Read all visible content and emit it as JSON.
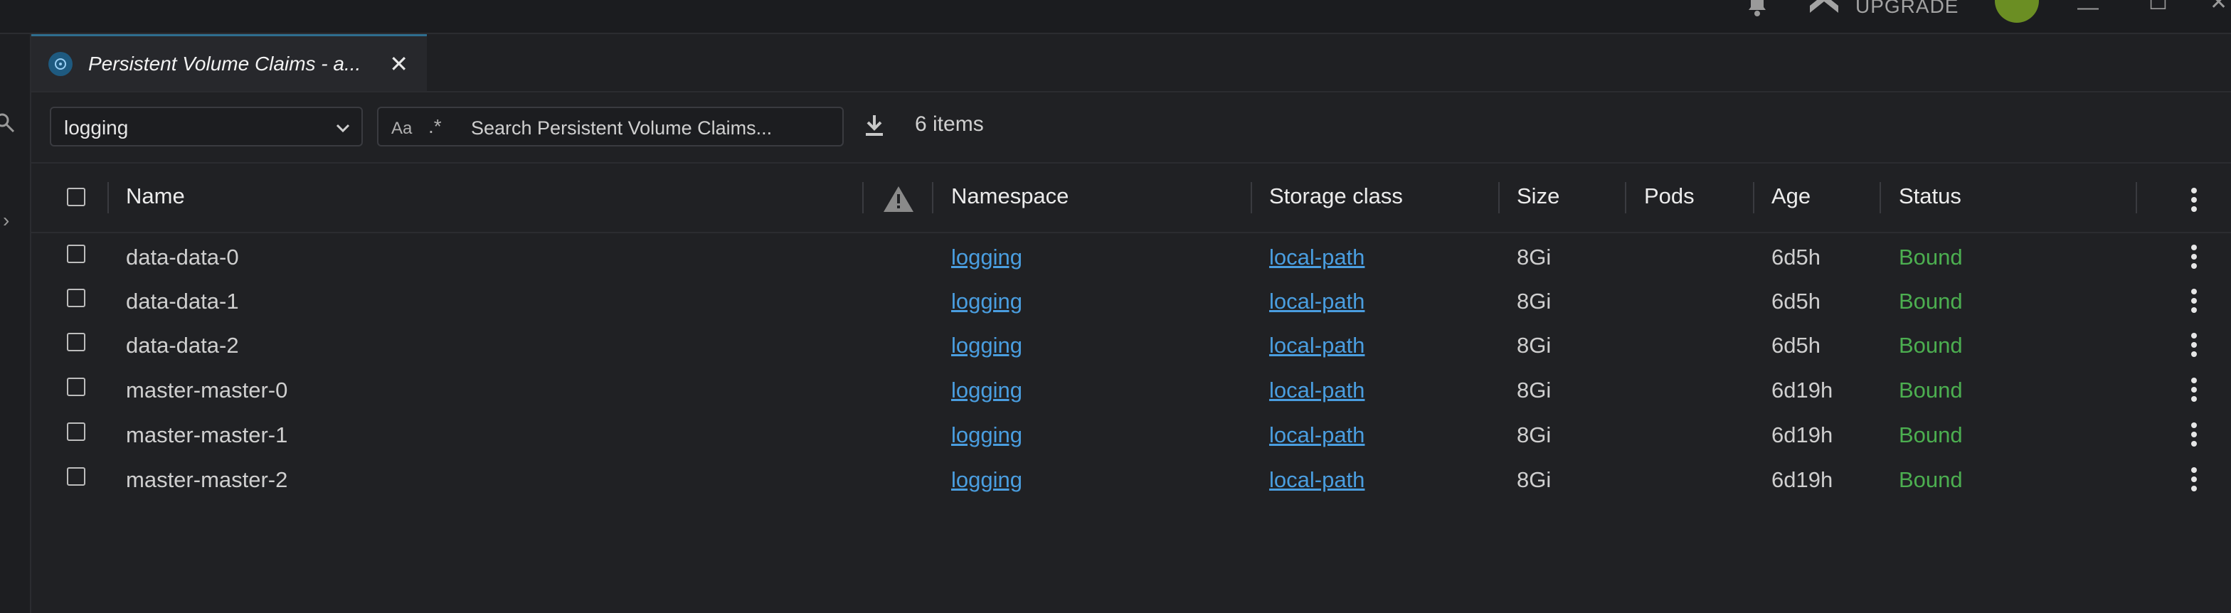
{
  "topbar": {
    "upgrade_label": "UPGRADE",
    "icons": [
      "bell-icon",
      "upgrade-icon",
      "avatar",
      "minimize-icon",
      "maximize-icon",
      "close-window-icon"
    ]
  },
  "tab": {
    "title": "Persistent Volume Claims - a...",
    "icon": "kubernetes-icon",
    "close_icon": "close-icon"
  },
  "toolbar": {
    "namespace_value": "logging",
    "search_case_label": "Aa",
    "search_regex_label": ".*",
    "search_placeholder": "Search Persistent Volume Claims...",
    "items_count": "6 items"
  },
  "table": {
    "columns": [
      "Name",
      "Namespace",
      "Storage class",
      "Size",
      "Pods",
      "Age",
      "Status"
    ],
    "rows": [
      {
        "name": "data-data-0",
        "namespace": "logging",
        "storage_class": "local-path",
        "size": "8Gi",
        "pods": "",
        "age": "6d5h",
        "status": "Bound"
      },
      {
        "name": "data-data-1",
        "namespace": "logging",
        "storage_class": "local-path",
        "size": "8Gi",
        "pods": "",
        "age": "6d5h",
        "status": "Bound"
      },
      {
        "name": "data-data-2",
        "namespace": "logging",
        "storage_class": "local-path",
        "size": "8Gi",
        "pods": "",
        "age": "6d5h",
        "status": "Bound"
      },
      {
        "name": "master-master-0",
        "namespace": "logging",
        "storage_class": "local-path",
        "size": "8Gi",
        "pods": "",
        "age": "6d19h",
        "status": "Bound"
      },
      {
        "name": "master-master-1",
        "namespace": "logging",
        "storage_class": "local-path",
        "size": "8Gi",
        "pods": "",
        "age": "6d19h",
        "status": "Bound"
      },
      {
        "name": "master-master-2",
        "namespace": "logging",
        "storage_class": "local-path",
        "size": "8Gi",
        "pods": "",
        "age": "6d19h",
        "status": "Bound"
      }
    ]
  },
  "colors": {
    "background": "#202124",
    "link": "#4a9ee0",
    "status_bound": "#4caf50",
    "accent_tab": "#2f6e8f"
  }
}
